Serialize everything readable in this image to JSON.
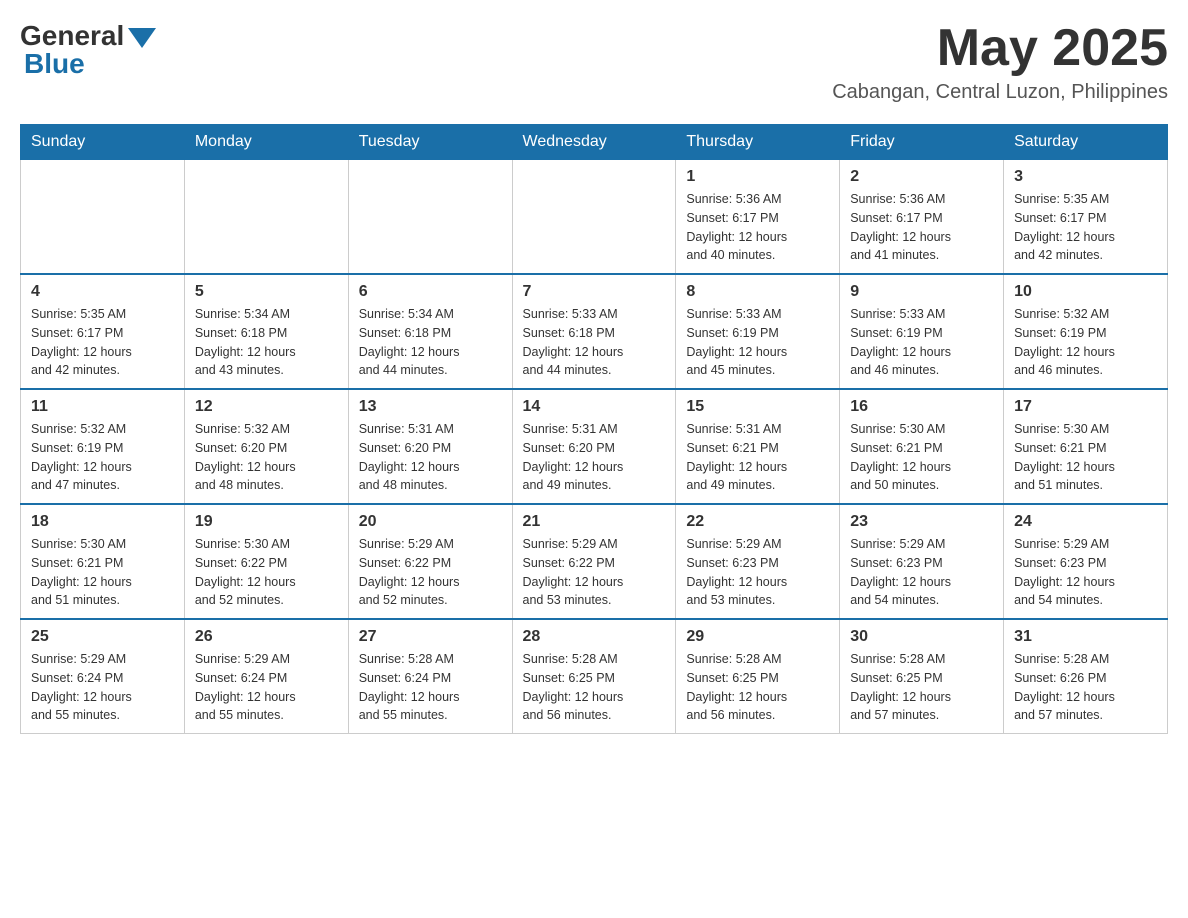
{
  "header": {
    "logo": {
      "general": "General",
      "blue": "Blue"
    },
    "title": "May 2025",
    "location": "Cabangan, Central Luzon, Philippines"
  },
  "weekdays": [
    "Sunday",
    "Monday",
    "Tuesday",
    "Wednesday",
    "Thursday",
    "Friday",
    "Saturday"
  ],
  "weeks": [
    [
      {
        "day": "",
        "info": ""
      },
      {
        "day": "",
        "info": ""
      },
      {
        "day": "",
        "info": ""
      },
      {
        "day": "",
        "info": ""
      },
      {
        "day": "1",
        "info": "Sunrise: 5:36 AM\nSunset: 6:17 PM\nDaylight: 12 hours\nand 40 minutes."
      },
      {
        "day": "2",
        "info": "Sunrise: 5:36 AM\nSunset: 6:17 PM\nDaylight: 12 hours\nand 41 minutes."
      },
      {
        "day": "3",
        "info": "Sunrise: 5:35 AM\nSunset: 6:17 PM\nDaylight: 12 hours\nand 42 minutes."
      }
    ],
    [
      {
        "day": "4",
        "info": "Sunrise: 5:35 AM\nSunset: 6:17 PM\nDaylight: 12 hours\nand 42 minutes."
      },
      {
        "day": "5",
        "info": "Sunrise: 5:34 AM\nSunset: 6:18 PM\nDaylight: 12 hours\nand 43 minutes."
      },
      {
        "day": "6",
        "info": "Sunrise: 5:34 AM\nSunset: 6:18 PM\nDaylight: 12 hours\nand 44 minutes."
      },
      {
        "day": "7",
        "info": "Sunrise: 5:33 AM\nSunset: 6:18 PM\nDaylight: 12 hours\nand 44 minutes."
      },
      {
        "day": "8",
        "info": "Sunrise: 5:33 AM\nSunset: 6:19 PM\nDaylight: 12 hours\nand 45 minutes."
      },
      {
        "day": "9",
        "info": "Sunrise: 5:33 AM\nSunset: 6:19 PM\nDaylight: 12 hours\nand 46 minutes."
      },
      {
        "day": "10",
        "info": "Sunrise: 5:32 AM\nSunset: 6:19 PM\nDaylight: 12 hours\nand 46 minutes."
      }
    ],
    [
      {
        "day": "11",
        "info": "Sunrise: 5:32 AM\nSunset: 6:19 PM\nDaylight: 12 hours\nand 47 minutes."
      },
      {
        "day": "12",
        "info": "Sunrise: 5:32 AM\nSunset: 6:20 PM\nDaylight: 12 hours\nand 48 minutes."
      },
      {
        "day": "13",
        "info": "Sunrise: 5:31 AM\nSunset: 6:20 PM\nDaylight: 12 hours\nand 48 minutes."
      },
      {
        "day": "14",
        "info": "Sunrise: 5:31 AM\nSunset: 6:20 PM\nDaylight: 12 hours\nand 49 minutes."
      },
      {
        "day": "15",
        "info": "Sunrise: 5:31 AM\nSunset: 6:21 PM\nDaylight: 12 hours\nand 49 minutes."
      },
      {
        "day": "16",
        "info": "Sunrise: 5:30 AM\nSunset: 6:21 PM\nDaylight: 12 hours\nand 50 minutes."
      },
      {
        "day": "17",
        "info": "Sunrise: 5:30 AM\nSunset: 6:21 PM\nDaylight: 12 hours\nand 51 minutes."
      }
    ],
    [
      {
        "day": "18",
        "info": "Sunrise: 5:30 AM\nSunset: 6:21 PM\nDaylight: 12 hours\nand 51 minutes."
      },
      {
        "day": "19",
        "info": "Sunrise: 5:30 AM\nSunset: 6:22 PM\nDaylight: 12 hours\nand 52 minutes."
      },
      {
        "day": "20",
        "info": "Sunrise: 5:29 AM\nSunset: 6:22 PM\nDaylight: 12 hours\nand 52 minutes."
      },
      {
        "day": "21",
        "info": "Sunrise: 5:29 AM\nSunset: 6:22 PM\nDaylight: 12 hours\nand 53 minutes."
      },
      {
        "day": "22",
        "info": "Sunrise: 5:29 AM\nSunset: 6:23 PM\nDaylight: 12 hours\nand 53 minutes."
      },
      {
        "day": "23",
        "info": "Sunrise: 5:29 AM\nSunset: 6:23 PM\nDaylight: 12 hours\nand 54 minutes."
      },
      {
        "day": "24",
        "info": "Sunrise: 5:29 AM\nSunset: 6:23 PM\nDaylight: 12 hours\nand 54 minutes."
      }
    ],
    [
      {
        "day": "25",
        "info": "Sunrise: 5:29 AM\nSunset: 6:24 PM\nDaylight: 12 hours\nand 55 minutes."
      },
      {
        "day": "26",
        "info": "Sunrise: 5:29 AM\nSunset: 6:24 PM\nDaylight: 12 hours\nand 55 minutes."
      },
      {
        "day": "27",
        "info": "Sunrise: 5:28 AM\nSunset: 6:24 PM\nDaylight: 12 hours\nand 55 minutes."
      },
      {
        "day": "28",
        "info": "Sunrise: 5:28 AM\nSunset: 6:25 PM\nDaylight: 12 hours\nand 56 minutes."
      },
      {
        "day": "29",
        "info": "Sunrise: 5:28 AM\nSunset: 6:25 PM\nDaylight: 12 hours\nand 56 minutes."
      },
      {
        "day": "30",
        "info": "Sunrise: 5:28 AM\nSunset: 6:25 PM\nDaylight: 12 hours\nand 57 minutes."
      },
      {
        "day": "31",
        "info": "Sunrise: 5:28 AM\nSunset: 6:26 PM\nDaylight: 12 hours\nand 57 minutes."
      }
    ]
  ]
}
